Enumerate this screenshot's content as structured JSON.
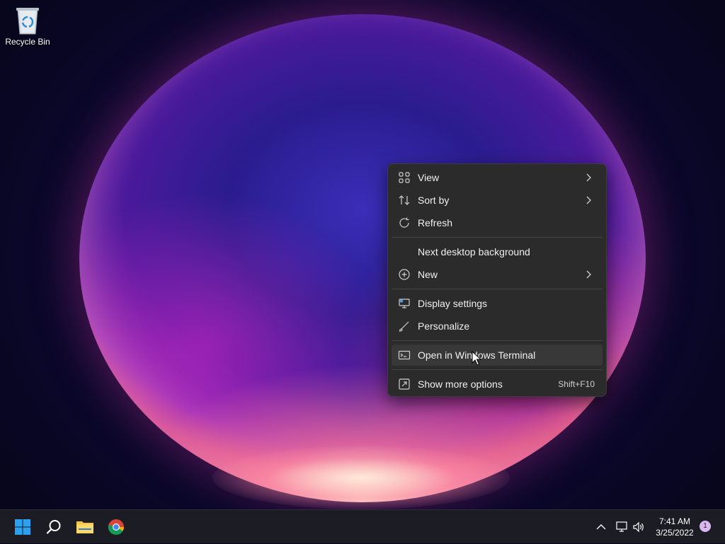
{
  "desktop": {
    "icons": [
      {
        "label": "Recycle Bin",
        "icon": "recycle-bin-icon"
      }
    ]
  },
  "context_menu": {
    "items": [
      {
        "label": "View",
        "icon": "grid-icon",
        "submenu": true
      },
      {
        "label": "Sort by",
        "icon": "sort-icon",
        "submenu": true
      },
      {
        "label": "Refresh",
        "icon": "refresh-icon",
        "submenu": false
      },
      {
        "label": "Next desktop background",
        "icon": "",
        "submenu": false
      },
      {
        "label": "New",
        "icon": "plus-circle-icon",
        "submenu": true
      },
      {
        "label": "Display settings",
        "icon": "display-icon",
        "submenu": false
      },
      {
        "label": "Personalize",
        "icon": "brush-icon",
        "submenu": false
      },
      {
        "label": "Open in Windows Terminal",
        "icon": "terminal-icon",
        "submenu": false,
        "highlighted": true
      },
      {
        "label": "Show more options",
        "icon": "more-options-icon",
        "shortcut": "Shift+F10"
      }
    ]
  },
  "taskbar": {
    "pinned": [
      {
        "name": "Start",
        "icon": "windows-start-icon"
      },
      {
        "name": "Search",
        "icon": "search-icon"
      },
      {
        "name": "File Explorer",
        "icon": "folder-icon"
      },
      {
        "name": "Google Chrome",
        "icon": "chrome-icon"
      }
    ],
    "tray": {
      "icons": [
        "chevron-up-icon",
        "network-icon",
        "volume-icon"
      ],
      "time": "7:41 AM",
      "date": "3/25/2022",
      "notification_count": "1"
    }
  },
  "colors": {
    "menu_bg": "#2b2b2b",
    "menu_hover": "#383838",
    "taskbar_bg": "#1c1c24",
    "accent": "#0078d4"
  }
}
